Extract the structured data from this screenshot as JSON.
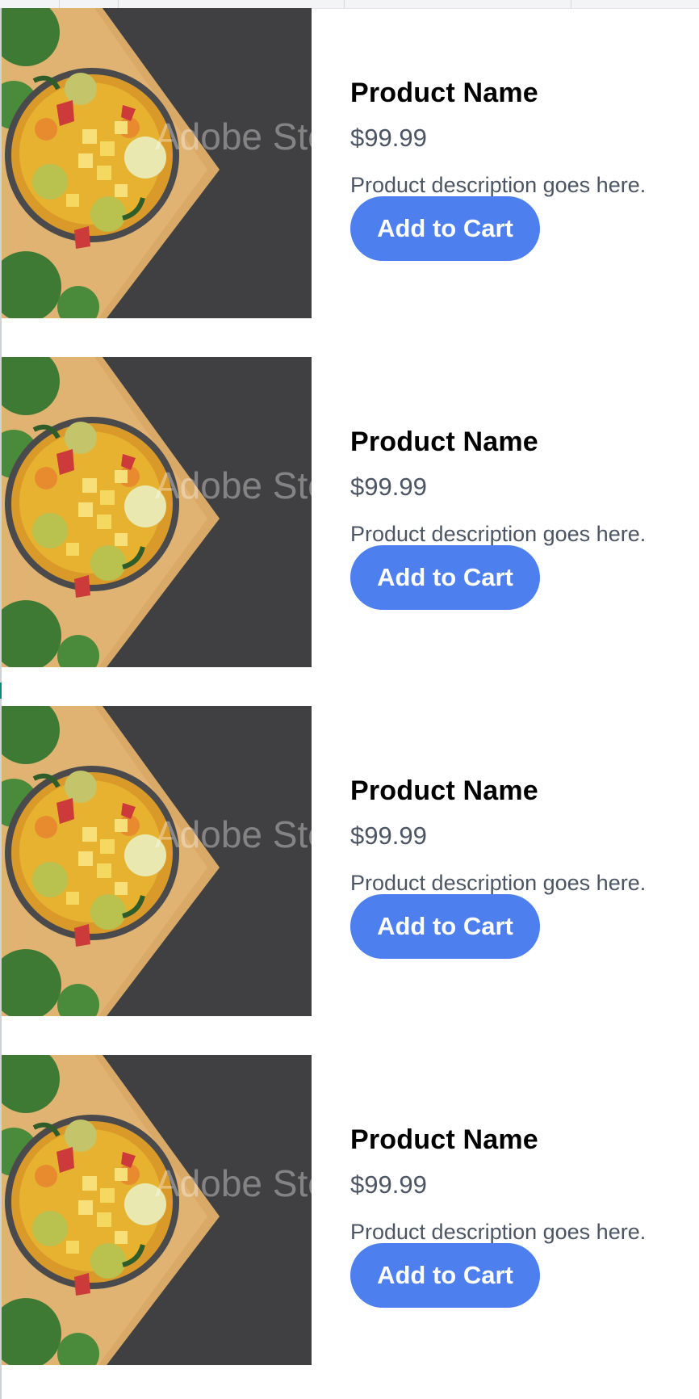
{
  "products": [
    {
      "name": "Product Name",
      "price": "$99.99",
      "description": "Product description goes here.",
      "button_label": "Add to Cart",
      "watermark": "Adobe Stock"
    },
    {
      "name": "Product Name",
      "price": "$99.99",
      "description": "Product description goes here.",
      "button_label": "Add to Cart",
      "watermark": "Adobe Stock"
    },
    {
      "name": "Product Name",
      "price": "$99.99",
      "description": "Product description goes here.",
      "button_label": "Add to Cart",
      "watermark": "Adobe Stock"
    },
    {
      "name": "Product Name",
      "price": "$99.99",
      "description": "Product description goes here.",
      "button_label": "Add to Cart",
      "watermark": "Adobe Stock"
    }
  ],
  "colors": {
    "button": "#4d80ee",
    "price_text": "#4b5563",
    "title_text": "#000000"
  }
}
